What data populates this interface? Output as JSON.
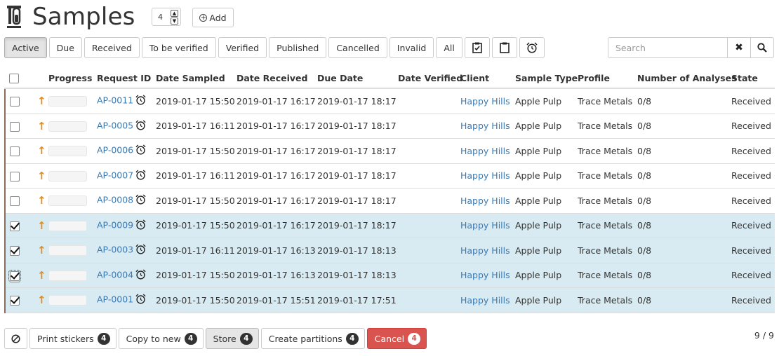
{
  "page": {
    "title": "Samples",
    "copies": "4",
    "add_label": "Add"
  },
  "filters": [
    "Active",
    "Due",
    "Received",
    "To be verified",
    "Verified",
    "Published",
    "Cancelled",
    "Invalid",
    "All"
  ],
  "filter_icons": [
    "clipboard-check-icon",
    "clipboard-icon",
    "alarm-clock-icon"
  ],
  "search": {
    "placeholder": "Search"
  },
  "table": {
    "columns": [
      "Progress",
      "Request ID",
      "Date Sampled",
      "Date Received",
      "Due Date",
      "Date Verified",
      "Client",
      "Sample Type",
      "Profile",
      "Number of Analyses",
      "State"
    ],
    "rows": [
      {
        "id": "AP-0011",
        "sampled": "2019-01-17 15:50",
        "received": "2019-01-17 16:17",
        "due": "2019-01-17 18:17",
        "verified": "",
        "client": "Happy Hills",
        "type": "Apple Pulp",
        "profile": "Trace Metals",
        "analyses": "0/8",
        "state": "Received",
        "checked": false
      },
      {
        "id": "AP-0005",
        "sampled": "2019-01-17 16:11",
        "received": "2019-01-17 16:17",
        "due": "2019-01-17 18:17",
        "verified": "",
        "client": "Happy Hills",
        "type": "Apple Pulp",
        "profile": "Trace Metals",
        "analyses": "0/8",
        "state": "Received",
        "checked": false
      },
      {
        "id": "AP-0006",
        "sampled": "2019-01-17 15:50",
        "received": "2019-01-17 16:17",
        "due": "2019-01-17 18:17",
        "verified": "",
        "client": "Happy Hills",
        "type": "Apple Pulp",
        "profile": "Trace Metals",
        "analyses": "0/8",
        "state": "Received",
        "checked": false
      },
      {
        "id": "AP-0007",
        "sampled": "2019-01-17 16:11",
        "received": "2019-01-17 16:17",
        "due": "2019-01-17 18:17",
        "verified": "",
        "client": "Happy Hills",
        "type": "Apple Pulp",
        "profile": "Trace Metals",
        "analyses": "0/8",
        "state": "Received",
        "checked": false
      },
      {
        "id": "AP-0008",
        "sampled": "2019-01-17 15:50",
        "received": "2019-01-17 16:17",
        "due": "2019-01-17 18:17",
        "verified": "",
        "client": "Happy Hills",
        "type": "Apple Pulp",
        "profile": "Trace Metals",
        "analyses": "0/8",
        "state": "Received",
        "checked": false
      },
      {
        "id": "AP-0009",
        "sampled": "2019-01-17 15:50",
        "received": "2019-01-17 16:17",
        "due": "2019-01-17 18:17",
        "verified": "",
        "client": "Happy Hills",
        "type": "Apple Pulp",
        "profile": "Trace Metals",
        "analyses": "0/8",
        "state": "Received",
        "checked": true
      },
      {
        "id": "AP-0003",
        "sampled": "2019-01-17 16:11",
        "received": "2019-01-17 16:13",
        "due": "2019-01-17 18:13",
        "verified": "",
        "client": "Happy Hills",
        "type": "Apple Pulp",
        "profile": "Trace Metals",
        "analyses": "0/8",
        "state": "Received",
        "checked": true
      },
      {
        "id": "AP-0004",
        "sampled": "2019-01-17 15:50",
        "received": "2019-01-17 16:13",
        "due": "2019-01-17 18:13",
        "verified": "",
        "client": "Happy Hills",
        "type": "Apple Pulp",
        "profile": "Trace Metals",
        "analyses": "0/8",
        "state": "Received",
        "checked": true
      },
      {
        "id": "AP-0001",
        "sampled": "2019-01-17 15:50",
        "received": "2019-01-17 15:51",
        "due": "2019-01-17 17:51",
        "verified": "",
        "client": "Happy Hills",
        "type": "Apple Pulp",
        "profile": "Trace Metals",
        "analyses": "0/8",
        "state": "Received",
        "checked": true
      }
    ]
  },
  "actions": [
    {
      "label": "Print stickers",
      "count": "4",
      "style": "default"
    },
    {
      "label": "Copy to new",
      "count": "4",
      "style": "default"
    },
    {
      "label": "Store",
      "count": "4",
      "style": "store"
    },
    {
      "label": "Create partitions",
      "count": "4",
      "style": "default"
    },
    {
      "label": "Cancel",
      "count": "4",
      "style": "danger"
    }
  ],
  "pager": "9 / 9",
  "colors": {
    "link": "#3a7ab3",
    "priority": "#e48c1a",
    "selected_row": "#d9ebf2",
    "danger": "#d9534f"
  }
}
